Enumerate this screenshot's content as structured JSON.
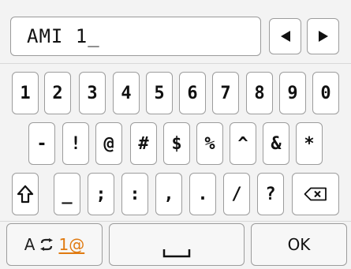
{
  "input": {
    "value": "AMI 1_"
  },
  "cursor_buttons": {
    "left_icon": "left-triangle-icon",
    "right_icon": "right-triangle-icon"
  },
  "rows": {
    "digits": [
      "1",
      "2",
      "3",
      "4",
      "5",
      "6",
      "7",
      "8",
      "9",
      "0"
    ],
    "symbols1": [
      "-",
      "!",
      "@",
      "#",
      "$",
      "%",
      "^",
      "&",
      "*"
    ],
    "symbols2": [
      "_",
      ";",
      ":",
      ",",
      ".",
      "/",
      "?"
    ]
  },
  "special_keys": {
    "shift_icon": "shift-arrow-icon",
    "backspace_icon": "backspace-icon"
  },
  "bottom": {
    "mode_alpha": "A",
    "mode_symbols": "1@",
    "space_icon": "space-bar-icon",
    "ok_label": "OK"
  },
  "colors": {
    "accent": "#e07a10",
    "key_bg": "#ffffff",
    "screen_bg": "#f3f3f3"
  }
}
